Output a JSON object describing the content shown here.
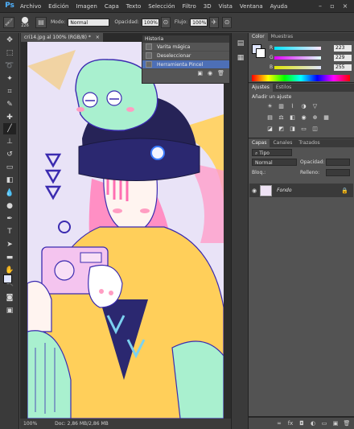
{
  "app": {
    "logo": "Ps"
  },
  "menu": [
    "Archivo",
    "Edición",
    "Imagen",
    "Capa",
    "Texto",
    "Selección",
    "Filtro",
    "3D",
    "Vista",
    "Ventana",
    "Ayuda"
  ],
  "options": {
    "brush_size": "226",
    "mode_label": "Modo:",
    "mode_value": "Normal",
    "opacity_label": "Opacidad:",
    "opacity_value": "100%",
    "flow_label": "Flujo:",
    "flow_value": "100%"
  },
  "document": {
    "tab": "cri14.jpg al 100% (RGB/8) *",
    "zoom": "100%",
    "doc_info": "Doc: 2,86 MB/2,86 MB"
  },
  "history": {
    "title": "Historia",
    "items": [
      "Varita mágica",
      "Deseleccionar",
      "Herramienta Pincel"
    ],
    "selected_index": 2
  },
  "color_panel": {
    "tabs": [
      "Color",
      "Muestras"
    ],
    "r": "223",
    "g": "229",
    "b": "255",
    "r_label": "R",
    "g_label": "G",
    "b_label": "B"
  },
  "adjustments": {
    "tabs": [
      "Ajustes",
      "Estilos"
    ],
    "heading": "Añadir un ajuste"
  },
  "layers": {
    "tabs": [
      "Capas",
      "Canales",
      "Trazados"
    ],
    "filter_label": "Tipo",
    "blend_mode": "Normal",
    "opacity_label": "Opacidad:",
    "lock_label": "Bloq.:",
    "fill_label": "Relleno:",
    "layer_name": "Fondo"
  },
  "colors": {
    "accent": "#4d6fb6",
    "fg_swatch": "#dfe5ff",
    "canvas_bg": "#e7e1f6",
    "hair_pink": "#ff8fc4",
    "mint": "#a9f0cf",
    "beanie_navy": "#262357",
    "sweater_yellow": "#ffcf5a",
    "line_purple": "#3b2bb0"
  }
}
